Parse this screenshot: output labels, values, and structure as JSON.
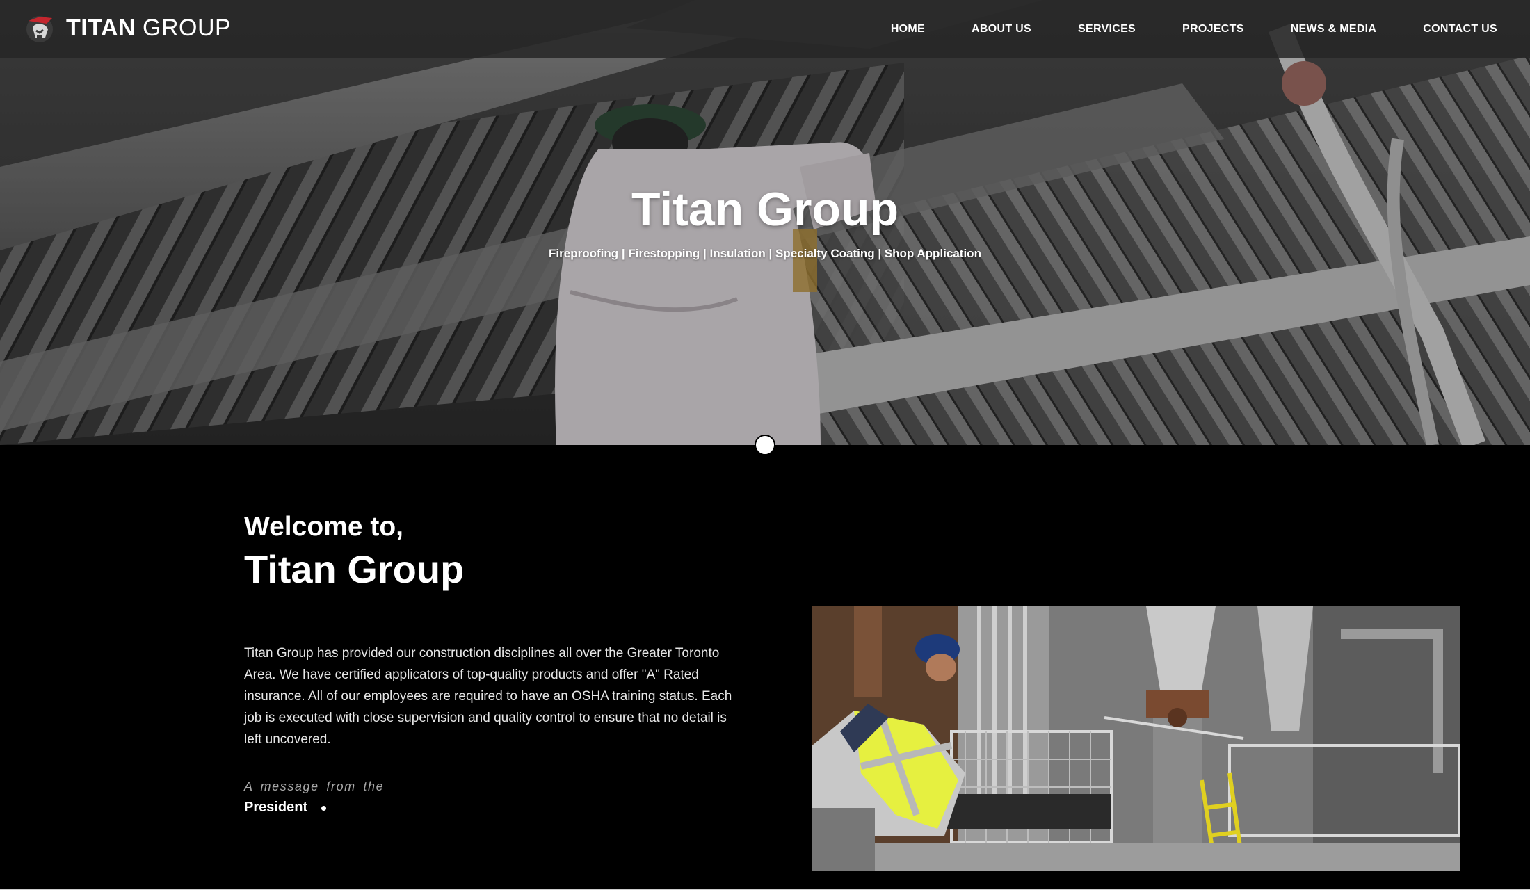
{
  "brand": {
    "name_bold": "TITAN",
    "name_light": "GROUP",
    "logo_icon": "titan-helmet-logo"
  },
  "nav": {
    "items": [
      {
        "label": "HOME"
      },
      {
        "label": "ABOUT US"
      },
      {
        "label": "SERVICES"
      },
      {
        "label": "PROJECTS"
      },
      {
        "label": "NEWS & MEDIA"
      },
      {
        "label": "CONTACT US"
      }
    ]
  },
  "hero": {
    "title": "Titan Group",
    "subtitle": "Fireproofing | Firestopping | Insulation | Specialty Coating | Shop Application",
    "image": "worker spraying fireproofing on steel ceiling beams",
    "slide_count": 1
  },
  "welcome": {
    "kicker": "Welcome to,",
    "title": "Titan Group",
    "body": "Titan Group has provided our construction disciplines all over the Greater Toronto Area. We have certified applicators of top-quality products and offer \"A\" Rated insurance. All of our employees are required to have an OSHA training status. Each job is executed with close supervision and quality control to ensure that no detail is left uncovered.",
    "message_from": "A message from the",
    "president_label": "President",
    "photo": "construction workers on site in high-visibility vests"
  },
  "colors": {
    "header_bg": "#262626",
    "page_bg": "#000000",
    "text": "#ffffff",
    "logo_accent": "#c4262e"
  }
}
